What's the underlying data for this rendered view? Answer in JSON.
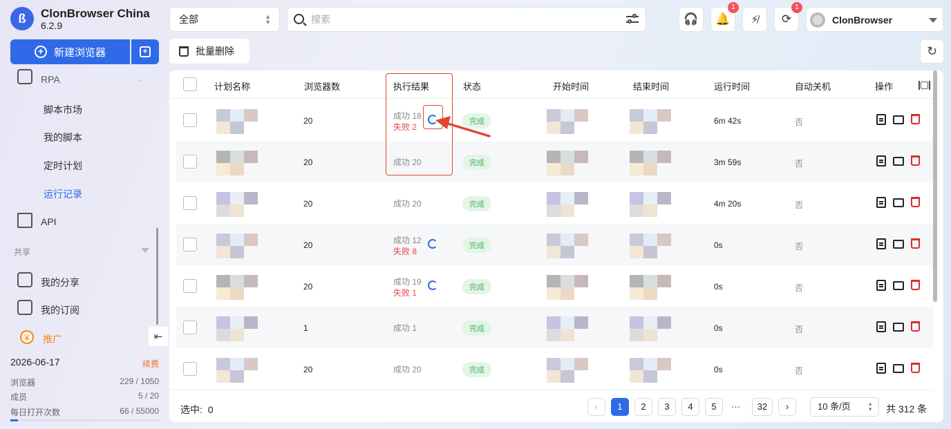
{
  "app": {
    "name": "ClonBrowser China",
    "version": "6.2.9"
  },
  "sidebar": {
    "new_browser": "新建浏览器",
    "rpa": "RPA",
    "items": [
      {
        "label": "脚本市场"
      },
      {
        "label": "我的脚本"
      },
      {
        "label": "定时计划"
      },
      {
        "label": "运行记录",
        "active": true
      }
    ],
    "api": "API",
    "share_section": "共享",
    "share_items": [
      {
        "label": "我的分享"
      },
      {
        "label": "我的订阅"
      }
    ],
    "promo": "推广",
    "expiry_date": "2026-06-17",
    "renew": "续费",
    "stats": [
      {
        "label": "浏览器",
        "value": "229 / 1050"
      },
      {
        "label": "成员",
        "value": "5 / 20"
      },
      {
        "label": "每日打开次数",
        "value": "66 / 55000"
      }
    ]
  },
  "topbar": {
    "filter_value": "全部",
    "search_placeholder": "搜索",
    "notification_badge": "1",
    "sync_badge": "1",
    "username": "ClonBrowser"
  },
  "toolbar": {
    "bulk_delete": "批量删除"
  },
  "table": {
    "headers": [
      "计划名称",
      "浏览器数",
      "执行结果",
      "状态",
      "开始时间",
      "结束时间",
      "运行时间",
      "自动关机",
      "操作"
    ],
    "rows": [
      {
        "count": "20",
        "ok": "成功 18",
        "fail": "失败 2",
        "status": "完成",
        "duration": "6m 42s",
        "auto_off": "否"
      },
      {
        "count": "20",
        "ok": "成功 20",
        "fail": "",
        "status": "完成",
        "duration": "3m 59s",
        "auto_off": "否"
      },
      {
        "count": "20",
        "ok": "成功 20",
        "fail": "",
        "status": "完成",
        "duration": "4m 20s",
        "auto_off": "否"
      },
      {
        "count": "20",
        "ok": "成功 12",
        "fail": "失败 8",
        "status": "完成",
        "duration": "0s",
        "auto_off": "否"
      },
      {
        "count": "20",
        "ok": "成功 19",
        "fail": "失败 1",
        "status": "完成",
        "duration": "0s",
        "auto_off": "否"
      },
      {
        "count": "1",
        "ok": "成功 1",
        "fail": "",
        "status": "完成",
        "duration": "0s",
        "auto_off": "否"
      },
      {
        "count": "20",
        "ok": "成功 20",
        "fail": "",
        "status": "完成",
        "duration": "0s",
        "auto_off": "否"
      }
    ]
  },
  "footer": {
    "selected_label": "选中:",
    "selected_count": "0",
    "pages": [
      "1",
      "2",
      "3",
      "4",
      "5",
      "32"
    ],
    "current_page": "1",
    "page_size": "10 条/页",
    "total": "共 312 条"
  },
  "colors": {
    "accent": "#2f6ae8",
    "fail": "#e5484d",
    "success_tag": "#4caf63",
    "annotation": "#e0462e"
  }
}
